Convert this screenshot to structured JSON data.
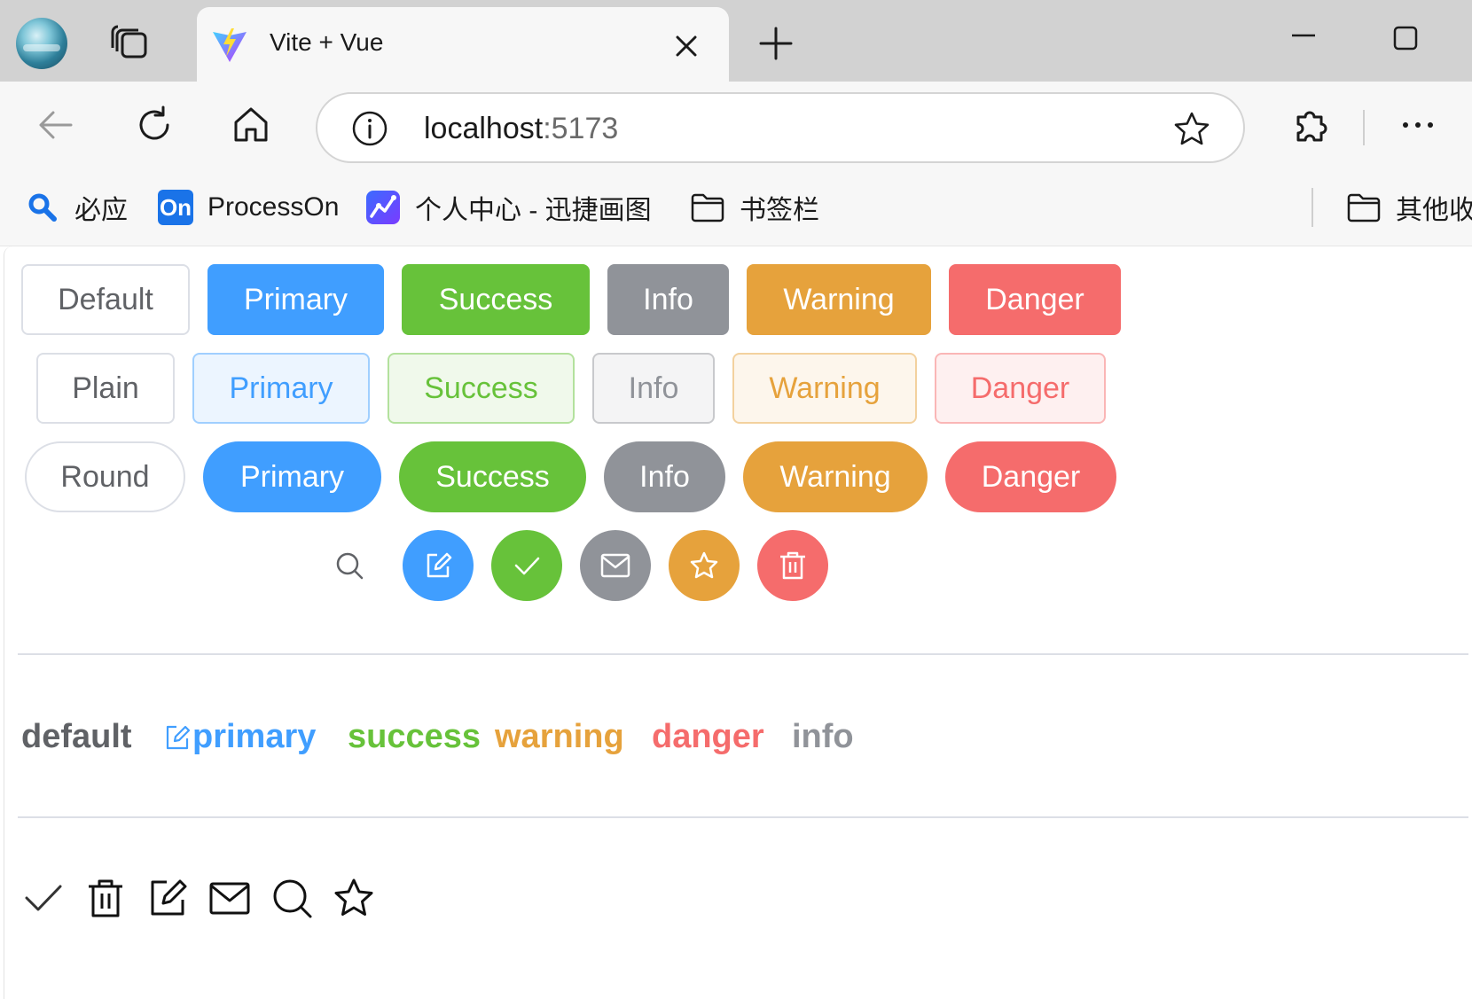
{
  "browser": {
    "tab": {
      "title": "Vite + Vue"
    },
    "address": {
      "host": "localhost",
      "port": ":5173"
    },
    "bookmarks": [
      {
        "label": "必应",
        "icon": "search-icon"
      },
      {
        "label": "ProcessOn",
        "icon": "processon-icon",
        "badge": "On"
      },
      {
        "label": "个人中心 - 迅捷画图",
        "icon": "chart-icon"
      },
      {
        "label": "书签栏",
        "icon": "folder-icon"
      },
      {
        "label": "其他收",
        "icon": "folder-icon"
      }
    ]
  },
  "buttons": {
    "row1": [
      "Default",
      "Primary",
      "Success",
      "Info",
      "Warning",
      "Danger"
    ],
    "row2": [
      "Plain",
      "Primary",
      "Success",
      "Info",
      "Warning",
      "Danger"
    ],
    "row3": [
      "Round",
      "Primary",
      "Success",
      "Info",
      "Warning",
      "Danger"
    ],
    "circle_icons": [
      "search-icon",
      "edit-icon",
      "check-icon",
      "message-icon",
      "star-icon",
      "delete-icon"
    ]
  },
  "links": [
    "default",
    "primary",
    "success",
    "warning",
    "danger",
    "info"
  ],
  "icons": [
    "check-icon",
    "delete-icon",
    "edit-icon",
    "message-icon",
    "search-icon",
    "star-icon"
  ],
  "colors": {
    "primary": "#409eff",
    "success": "#67c23a",
    "info": "#909399",
    "warning": "#e6a23c",
    "danger": "#f56c6c",
    "default_text": "#606266"
  }
}
